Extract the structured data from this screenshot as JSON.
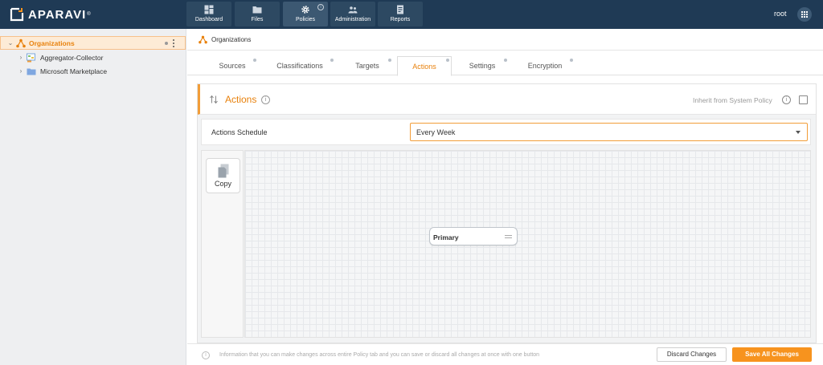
{
  "app": {
    "brand": "APARAVI",
    "user": "root"
  },
  "nav": [
    {
      "label": "Dashboard",
      "icon": "dashboard-icon"
    },
    {
      "label": "Files",
      "icon": "folder-icon"
    },
    {
      "label": "Policies",
      "icon": "gear-icon",
      "active": true
    },
    {
      "label": "Administration",
      "icon": "users-icon"
    },
    {
      "label": "Reports",
      "icon": "report-icon"
    }
  ],
  "sidebar": {
    "items": [
      {
        "label": "Organizations",
        "icon": "org-icon",
        "selected": true
      },
      {
        "label": "Aggregator-Collector",
        "icon": "aggregator-icon"
      },
      {
        "label": "Microsoft Marketplace",
        "icon": "folder-icon"
      }
    ]
  },
  "breadcrumb": {
    "label": "Organizations"
  },
  "tabs": [
    {
      "label": "Sources"
    },
    {
      "label": "Classifications"
    },
    {
      "label": "Targets"
    },
    {
      "label": "Actions",
      "active": true
    },
    {
      "label": "Settings"
    },
    {
      "label": "Encryption"
    }
  ],
  "actions": {
    "title": "Actions",
    "inherit_label": "Inherit from System Policy",
    "schedule_label": "Actions Schedule",
    "schedule_value": "Every Week",
    "palette_item": "Copy",
    "node_label": "Primary"
  },
  "footer": {
    "info_text": "Information that you can make changes across entire Policy tab and you can save or discard all changes at once with one button",
    "discard_label": "Discard Changes",
    "save_label": "Save All Changes"
  },
  "colors": {
    "topbar": "#1f3a55",
    "accent": "#f7931e",
    "sidebar_bg": "#eeeff1"
  }
}
